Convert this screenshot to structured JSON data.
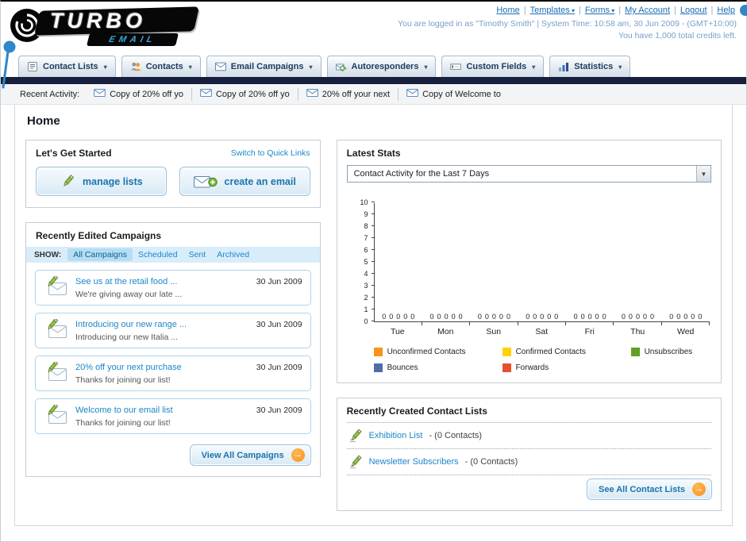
{
  "header": {
    "logo_text": "TURBO",
    "logo_sub": "EMAIL",
    "nav_links": [
      {
        "label": "Home",
        "dropdown": false
      },
      {
        "label": "Templates",
        "dropdown": true
      },
      {
        "label": "Forms",
        "dropdown": true
      },
      {
        "label": "My Account",
        "dropdown": false
      },
      {
        "label": "Logout",
        "dropdown": false
      },
      {
        "label": "Help",
        "dropdown": false
      }
    ],
    "login_info": "You are logged in as \"Timothy Smith\" | System Time: 10:58 am, 30 Jun 2009 - (GMT+10:00)",
    "credits_info": "You have 1,000 total credits left."
  },
  "nav_tabs": [
    {
      "label": "Contact Lists",
      "icon": "contact-lists-icon"
    },
    {
      "label": "Contacts",
      "icon": "contacts-icon"
    },
    {
      "label": "Email Campaigns",
      "icon": "email-campaigns-icon"
    },
    {
      "label": "Autoresponders",
      "icon": "autoresponders-icon"
    },
    {
      "label": "Custom Fields",
      "icon": "custom-fields-icon"
    },
    {
      "label": "Statistics",
      "icon": "statistics-icon"
    }
  ],
  "recent_activity": {
    "label": "Recent Activity:",
    "items": [
      "Copy of 20% off yo",
      "Copy of 20% off yo",
      "20% off your next",
      "Copy of Welcome to"
    ]
  },
  "page_title": "Home",
  "get_started": {
    "title": "Let's Get Started",
    "switch_link": "Switch to Quick Links",
    "manage_lists_label": "manage lists",
    "create_email_label": "create an email"
  },
  "campaigns": {
    "title": "Recently Edited Campaigns",
    "show_label": "SHOW:",
    "show_tabs": [
      {
        "label": "All Campaigns",
        "selected": true
      },
      {
        "label": "Scheduled",
        "selected": false
      },
      {
        "label": "Sent",
        "selected": false
      },
      {
        "label": "Archived",
        "selected": false
      }
    ],
    "items": [
      {
        "title": "See us at the retail food ...",
        "subtitle": "We're giving away our late ...",
        "date": "30 Jun 2009"
      },
      {
        "title": "Introducing our new range ...",
        "subtitle": "Introducing our new Italia ...",
        "date": "30 Jun 2009"
      },
      {
        "title": "20% off your next purchase",
        "subtitle": "Thanks for joining our list!",
        "date": "30 Jun 2009"
      },
      {
        "title": "Welcome to our email list",
        "subtitle": "Thanks for joining our list!",
        "date": "30 Jun 2009"
      }
    ],
    "view_all_label": "View All Campaigns"
  },
  "stats": {
    "title": "Latest Stats",
    "filter_value": "Contact Activity for the Last 7 Days",
    "chart_data": {
      "type": "bar",
      "title": "Contact Activity for the Last 7 Days",
      "categories": [
        "Tue",
        "Mon",
        "Sun",
        "Sat",
        "Fri",
        "Thu",
        "Wed"
      ],
      "series": [
        {
          "name": "Unconfirmed Contacts",
          "color": "#f7941d",
          "values": [
            0,
            0,
            0,
            0,
            0,
            0,
            0
          ]
        },
        {
          "name": "Confirmed Contacts",
          "color": "#ffd200",
          "values": [
            0,
            0,
            0,
            0,
            0,
            0,
            0
          ]
        },
        {
          "name": "Unsubscribes",
          "color": "#61a024",
          "values": [
            0,
            0,
            0,
            0,
            0,
            0,
            0
          ]
        },
        {
          "name": "Bounces",
          "color": "#4f6da8",
          "values": [
            0,
            0,
            0,
            0,
            0,
            0,
            0
          ]
        },
        {
          "name": "Forwards",
          "color": "#e8502d",
          "values": [
            0,
            0,
            0,
            0,
            0,
            0,
            0
          ]
        }
      ],
      "ylim": [
        0,
        10
      ],
      "yticks": [
        0,
        1,
        2,
        3,
        4,
        5,
        6,
        7,
        8,
        9,
        10
      ],
      "xlabel": "",
      "ylabel": "",
      "grid": false,
      "legend_position": "bottom"
    }
  },
  "contact_lists": {
    "title": "Recently Created Contact Lists",
    "items": [
      {
        "name": "Exhibition List",
        "detail": "- (0 Contacts)"
      },
      {
        "name": "Newsletter Subscribers",
        "detail": "- (0 Contacts)"
      }
    ],
    "see_all_label": "See All Contact Lists"
  }
}
